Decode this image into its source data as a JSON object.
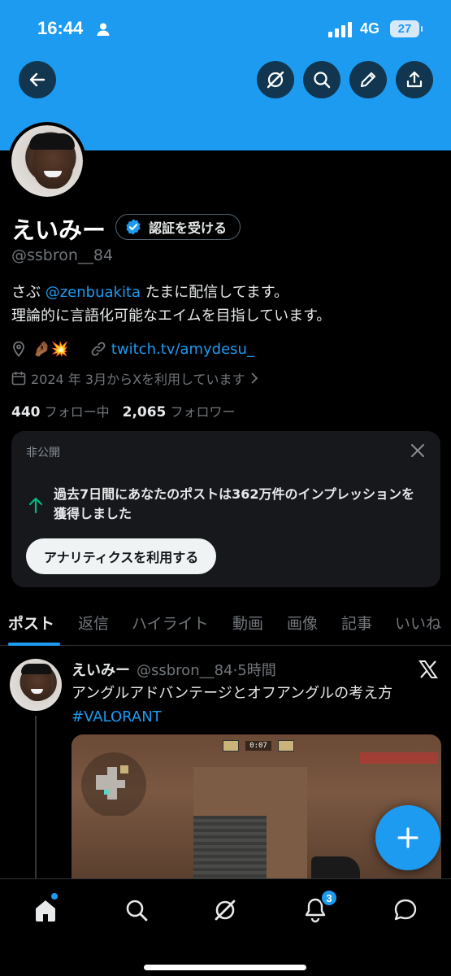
{
  "status_bar": {
    "time": "16:44",
    "network": "4G",
    "battery": "27"
  },
  "profile": {
    "display_name": "えいみー",
    "verify_button": "認証を受ける",
    "handle": "@ssbron__84",
    "bio_prefix": "さぶ ",
    "bio_mention": "@zenbuakita",
    "bio_suffix": " たまに配信してます。",
    "bio_line2": "理論的に言語化可能なエイムを目指しています。",
    "location_emoji": "🤌🏾💥",
    "website": "twitch.tv/amydesu_",
    "joined": "2024 年 3月からXを利用しています",
    "following_count": "440",
    "following_label": "フォロー中",
    "followers_count": "2,065",
    "followers_label": "フォロワー"
  },
  "private_card": {
    "label": "非公開",
    "message": "過去7日間にあなたのポストは362万件のインプレッションを獲得しました",
    "button": "アナリティクスを利用する"
  },
  "tabs": [
    "ポスト",
    "返信",
    "ハイライト",
    "動画",
    "画像",
    "記事",
    "いいね"
  ],
  "tweet": {
    "name": "えいみー",
    "handle": "@ssbron__84",
    "time": "·5時間",
    "text": "アングルアドバンテージとオフアングルの考え方",
    "hashtag": "#VALORANT",
    "media": {
      "hud_timer": "0:07"
    }
  },
  "bottom_nav": {
    "notification_badge": "3"
  },
  "colors": {
    "accent": "#1d9bf0",
    "background": "#000000",
    "card": "#16181c",
    "muted": "#71767b"
  },
  "icons": [
    "back-arrow-icon",
    "grok-icon",
    "search-icon",
    "edit-pencil-icon",
    "share-icon",
    "verified-badge-icon",
    "location-icon",
    "link-icon",
    "calendar-icon",
    "close-icon",
    "arrow-up-icon",
    "x-logo-icon",
    "plus-icon",
    "home-icon",
    "grok-icon",
    "bell-icon",
    "messages-icon"
  ]
}
